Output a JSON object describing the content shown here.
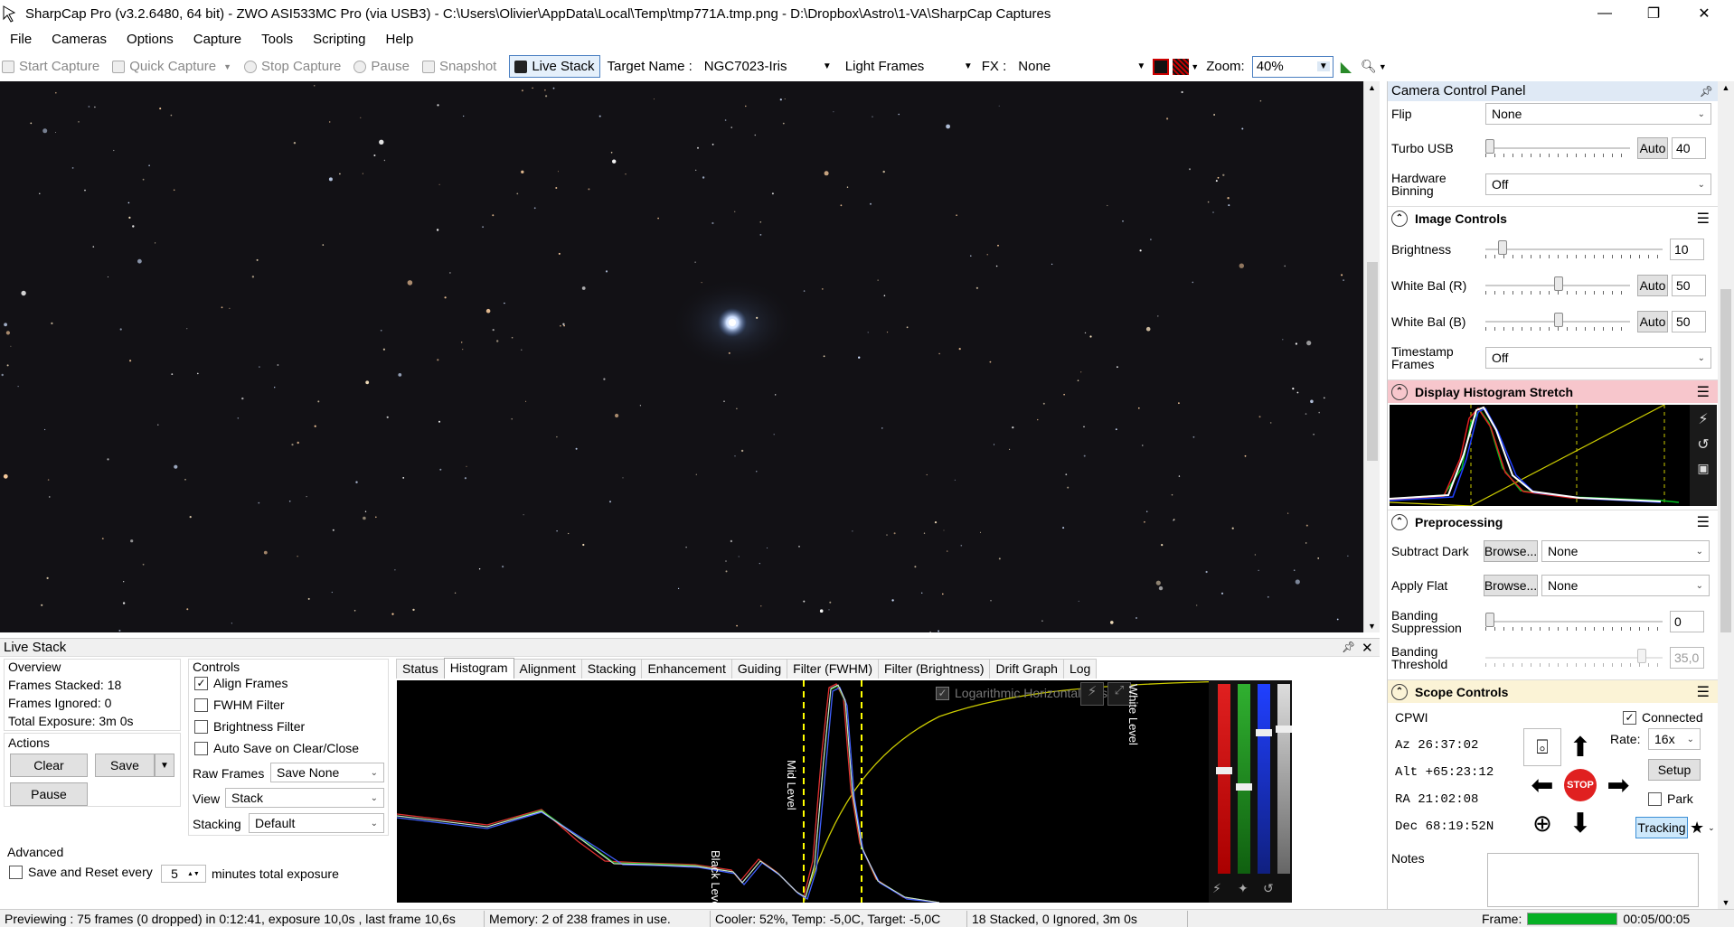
{
  "window": {
    "title": "SharpCap Pro (v3.2.6480, 64 bit) - ZWO ASI533MC Pro (via USB3) - C:\\Users\\Olivier\\AppData\\Local\\Temp\\tmp771A.tmp.png - D:\\Dropbox\\Astro\\1-VA\\SharpCap Captures",
    "minimize": "—",
    "restore": "❐",
    "close": "✕"
  },
  "menu": [
    "File",
    "Cameras",
    "Options",
    "Capture",
    "Tools",
    "Scripting",
    "Help"
  ],
  "toolbar": {
    "start_capture": "Start Capture",
    "quick_capture": "Quick Capture",
    "stop_capture": "Stop Capture",
    "pause": "Pause",
    "snapshot": "Snapshot",
    "live_stack": "Live Stack",
    "target_label": "Target Name :",
    "target_value": "NGC7023-Iris",
    "frame_type": "Light Frames",
    "fx_label": "FX :",
    "fx_value": "None",
    "zoom_label": "Zoom:",
    "zoom_value": "40%"
  },
  "camera_panel": {
    "header": "Camera Control Panel",
    "flip": {
      "label": "Flip",
      "value": "None"
    },
    "turbo_usb": {
      "label": "Turbo USB",
      "auto": "Auto",
      "value": "40"
    },
    "hardware_binning": {
      "label": "Hardware Binning",
      "value": "Off"
    },
    "image_controls": {
      "title": "Image Controls",
      "brightness": {
        "label": "Brightness",
        "value": "10"
      },
      "wb_r": {
        "label": "White Bal (R)",
        "auto": "Auto",
        "value": "50"
      },
      "wb_b": {
        "label": "White Bal (B)",
        "auto": "Auto",
        "value": "50"
      },
      "timestamp": {
        "label": "Timestamp Frames",
        "value": "Off"
      }
    },
    "histogram_stretch": {
      "title": "Display Histogram Stretch"
    },
    "preprocessing": {
      "title": "Preprocessing",
      "subtract_dark": {
        "label": "Subtract Dark",
        "browse": "Browse...",
        "value": "None"
      },
      "apply_flat": {
        "label": "Apply Flat",
        "browse": "Browse...",
        "value": "None"
      },
      "banding_suppression": {
        "label": "Banding Suppression",
        "value": "0"
      },
      "banding_threshold": {
        "label": "Banding Threshold",
        "value": "35,0"
      }
    },
    "scope": {
      "title": "Scope Controls",
      "name": "CPWI",
      "connected": "Connected",
      "az": "Az   26:37:02",
      "alt": "Alt +65:23:12",
      "ra": "RA   21:02:08",
      "dec": "Dec  68:19:52N",
      "rate_label": "Rate:",
      "rate_value": "16x",
      "setup": "Setup",
      "park": "Park",
      "tracking": "Tracking",
      "stop": "STOP"
    },
    "notes": {
      "label": "Notes"
    }
  },
  "livestack": {
    "title": "Live Stack",
    "overview": {
      "title": "Overview",
      "frames_stacked": "Frames Stacked:  18",
      "frames_ignored": "Frames Ignored:  0",
      "total_exposure": "Total Exposure:   3m 0s"
    },
    "actions": {
      "title": "Actions",
      "clear": "Clear",
      "save": "Save",
      "pause": "Pause"
    },
    "advanced": {
      "title": "Advanced",
      "save_reset": "Save and Reset every",
      "minutes_value": "5",
      "minutes_label": "minutes total exposure"
    },
    "controls": {
      "title": "Controls",
      "align": "Align Frames",
      "fwhm": "FWHM Filter",
      "brightness": "Brightness Filter",
      "autosave": "Auto Save on Clear/Close",
      "raw_frames_label": "Raw Frames",
      "raw_frames_value": "Save None",
      "view_label": "View",
      "view_value": "Stack",
      "stacking_label": "Stacking",
      "stacking_value": "Default"
    },
    "tabs": [
      "Status",
      "Histogram",
      "Alignment",
      "Stacking",
      "Enhancement",
      "Guiding",
      "Filter (FWHM)",
      "Filter (Brightness)",
      "Drift Graph",
      "Log"
    ],
    "histogram": {
      "log_axis": "Logarithmic Horizontal Axis",
      "black_level": "Black Level",
      "mid_level": "Mid Level",
      "white_level": "White Level"
    }
  },
  "status": {
    "preview": "Previewing : 75 frames (0 dropped) in 0:12:41, exposure 10,0s , last frame 10,6s",
    "memory": "Memory: 2 of 238 frames in use.",
    "cooler": "Cooler: 52%, Temp: -5,0C, Target: -5,0C",
    "stacked": "18 Stacked, 0 Ignored, 3m 0s",
    "frame_label": "Frame:",
    "frame_time": "00:05/00:05",
    "frame_progress": 1.0
  }
}
